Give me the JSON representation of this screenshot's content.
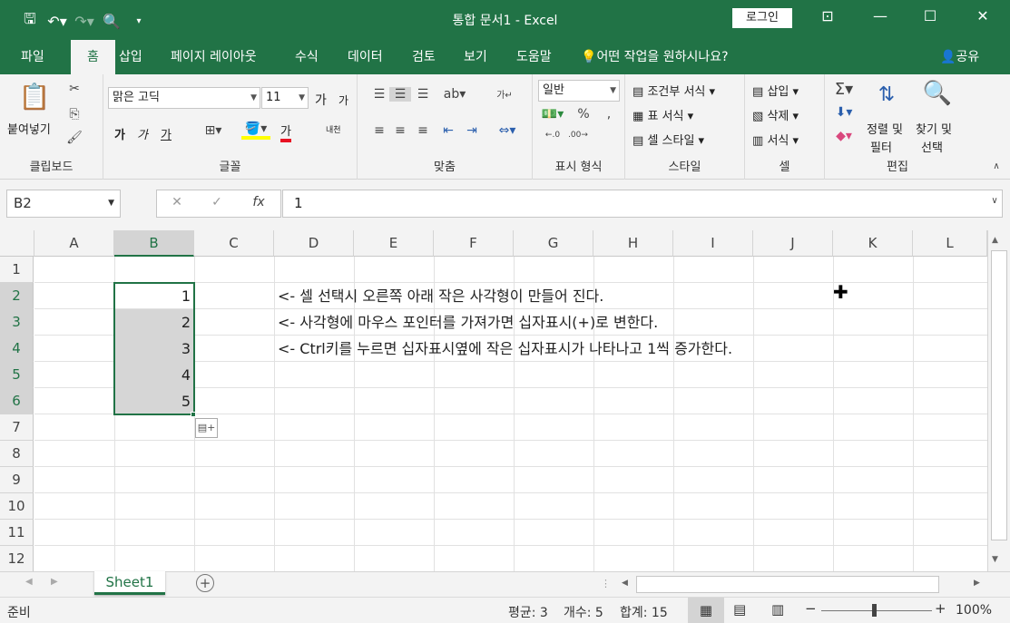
{
  "title": {
    "text": "통합 문서1  -  Excel",
    "login": "로그인"
  },
  "tabs": [
    "파일",
    "홈",
    "삽입",
    "페이지 레이아웃",
    "수식",
    "데이터",
    "검토",
    "보기",
    "도움말"
  ],
  "tell_me": "어떤 작업을 원하시나요?",
  "share": "공유",
  "ribbon": {
    "clipboard": {
      "paste": "붙여넣기",
      "label": "클립보드"
    },
    "font": {
      "name": "맑은 고딕",
      "size": "11",
      "grow": "가",
      "shrink": "가",
      "bold": "가",
      "italic": "가",
      "underline": "가",
      "phonetic": "내천",
      "color_letter": "가",
      "label": "글꼴"
    },
    "alignment": {
      "label": "맞춤"
    },
    "number": {
      "format": "일반",
      "label": "표시 형식"
    },
    "styles": {
      "cond": "조건부 서식",
      "table": "표 서식",
      "cell": "셀 스타일",
      "label": "스타일"
    },
    "cells": {
      "insert": "삽입",
      "delete": "삭제",
      "format": "서식",
      "label": "셀"
    },
    "editing": {
      "sort1": "정렬 및",
      "sort2": "필터",
      "find1": "찾기 및",
      "find2": "선택",
      "label": "편집"
    }
  },
  "namebox": "B2",
  "formula": "1",
  "columns": [
    "A",
    "B",
    "C",
    "D",
    "E",
    "F",
    "G",
    "H",
    "I",
    "J",
    "K",
    "L"
  ],
  "rows": [
    "1",
    "2",
    "3",
    "4",
    "5",
    "6",
    "7",
    "8",
    "9",
    "10",
    "11",
    "12"
  ],
  "cells": {
    "B2": "1",
    "B3": "2",
    "B4": "3",
    "B5": "4",
    "B6": "5"
  },
  "notes": [
    "<- 셀 선택시 오른쪽 아래 작은 사각형이 만들어 진다.",
    "<- 사각형에 마우스 포인터를 가져가면 십자표시(+)로 변한다.",
    "<- Ctrl키를 누르면 십자표시옆에 작은 십자표시가 나타나고 1씩 증가한다."
  ],
  "sheet_tab": "Sheet1",
  "status": {
    "ready": "준비",
    "average": "평균: 3",
    "count": "개수: 5",
    "sum": "합계: 15",
    "zoom": "100%"
  },
  "colors": {
    "accent": "#217346",
    "selection_fill": "#d6d6d6"
  }
}
